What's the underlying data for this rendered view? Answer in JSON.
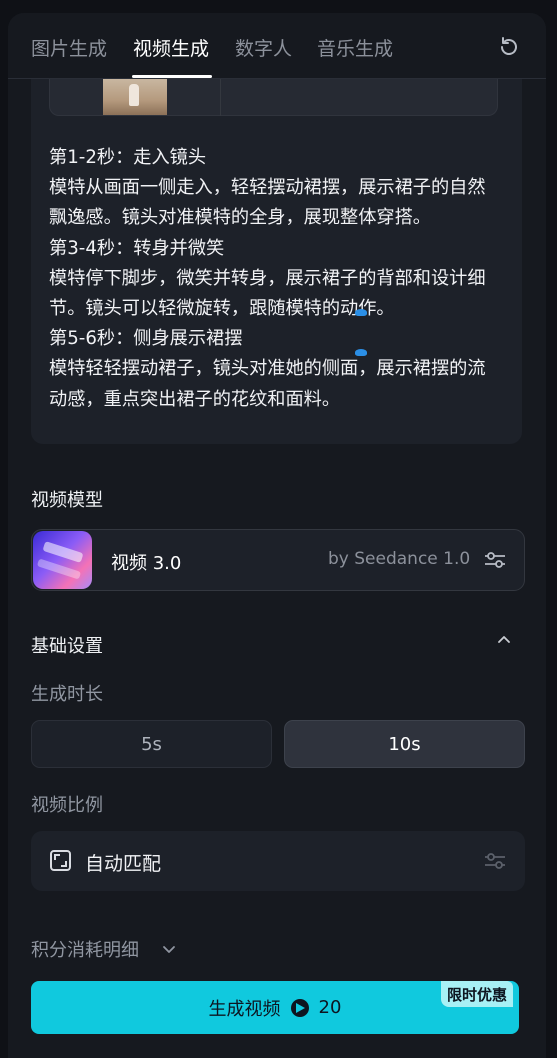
{
  "tabs": [
    {
      "label": "图片生成"
    },
    {
      "label": "视频生成"
    },
    {
      "label": "数字人"
    },
    {
      "label": "音乐生成"
    }
  ],
  "active_tab": "视频生成",
  "prompt_text": "第1-2秒：走入镜头\n模特从画面一侧走入，轻轻摆动裙摆，展示裙子的自然飘逸感。镜头对准模特的全身，展现整体穿搭。\n第3-4秒：转身并微笑\n模特停下脚步，微笑并转身，展示裙子的背部和设计细节。镜头可以轻微旋转，跟随模特的动作。\n第5-6秒：侧身展示裙摆\n模特轻轻摆动裙子，镜头对准她的侧面，展示裙摆的流动感，重点突出裙子的花纹和面料。",
  "video_model": {
    "section_label": "视频模型",
    "name": "视频 3.0",
    "by": "by Seedance 1.0"
  },
  "basic_settings": {
    "section_label": "基础设置",
    "duration_label": "生成时长",
    "durations": [
      "5s",
      "10s"
    ],
    "selected_duration": "10s",
    "ratio_label": "视频比例",
    "ratio_value": "自动匹配"
  },
  "credits_label": "积分消耗明细",
  "generate": {
    "label": "生成视频",
    "cost": "20",
    "promo_badge": "限时优惠"
  },
  "colors": {
    "accent": "#10c9de",
    "background": "#16191f",
    "card": "#1d2129"
  },
  "icons": [
    "refresh-icon",
    "sliders-icon",
    "chevron-up-icon",
    "aspect-ratio-icon",
    "chevron-down-icon",
    "credit-coin-icon"
  ]
}
